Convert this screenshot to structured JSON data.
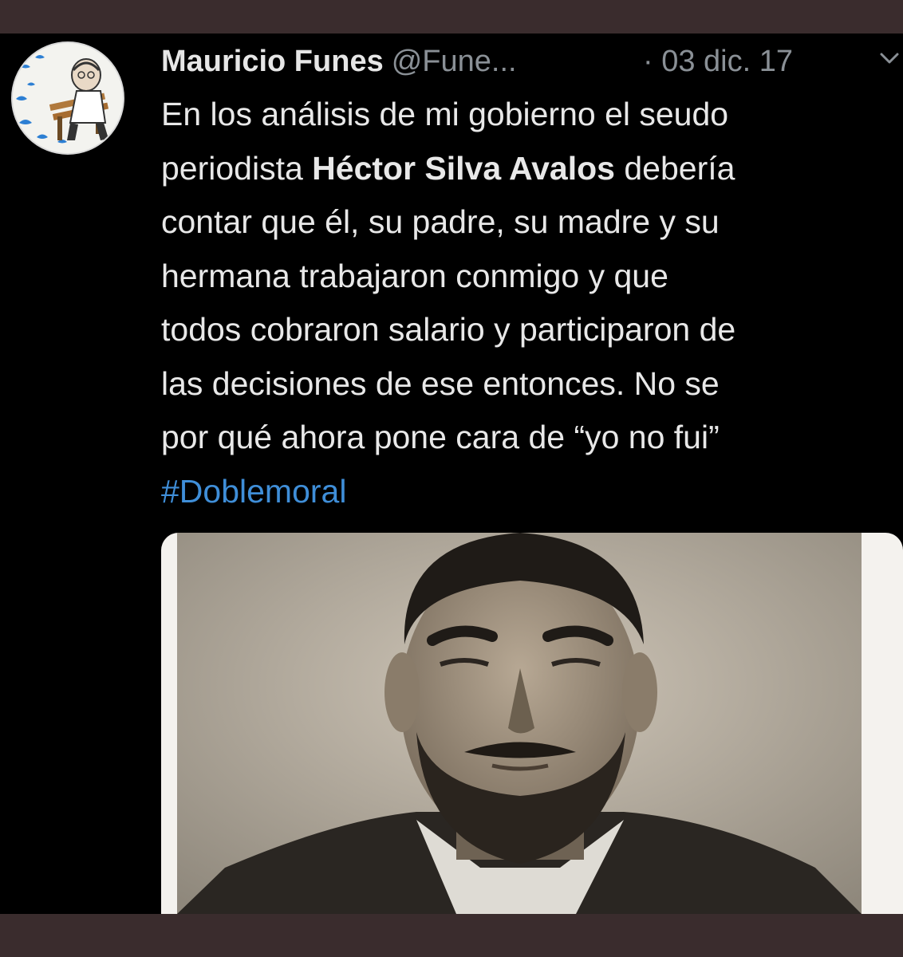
{
  "tweet": {
    "author_name": "Mauricio Funes",
    "author_handle": "@Fune...",
    "date": "· 03 dic. 17",
    "body": {
      "line1": "En los análisis de mi gobierno el seudo",
      "line2_pre": "periodista ",
      "line2_bold": "Héctor Silva Avalos",
      "line2_post": " debería",
      "line3": "contar que él, su padre, su madre y su",
      "line4": "hermana trabajaron conmigo y que",
      "line5": "todos cobraron salario y participaron de",
      "line6": "las decisiones de ese entonces. No se",
      "line7": "por qué ahora pone cara de “yo no fui”",
      "hashtag": "#Doblemoral"
    }
  },
  "icons": {
    "caret": "chevron-down-icon",
    "avatar": "avatar"
  },
  "colors": {
    "background": "#000000",
    "frame": "#3a2c2d",
    "name": "#e6e6e6",
    "meta": "#8a9096",
    "text": "#e8e8e8",
    "hashtag": "#3f8ed8"
  }
}
